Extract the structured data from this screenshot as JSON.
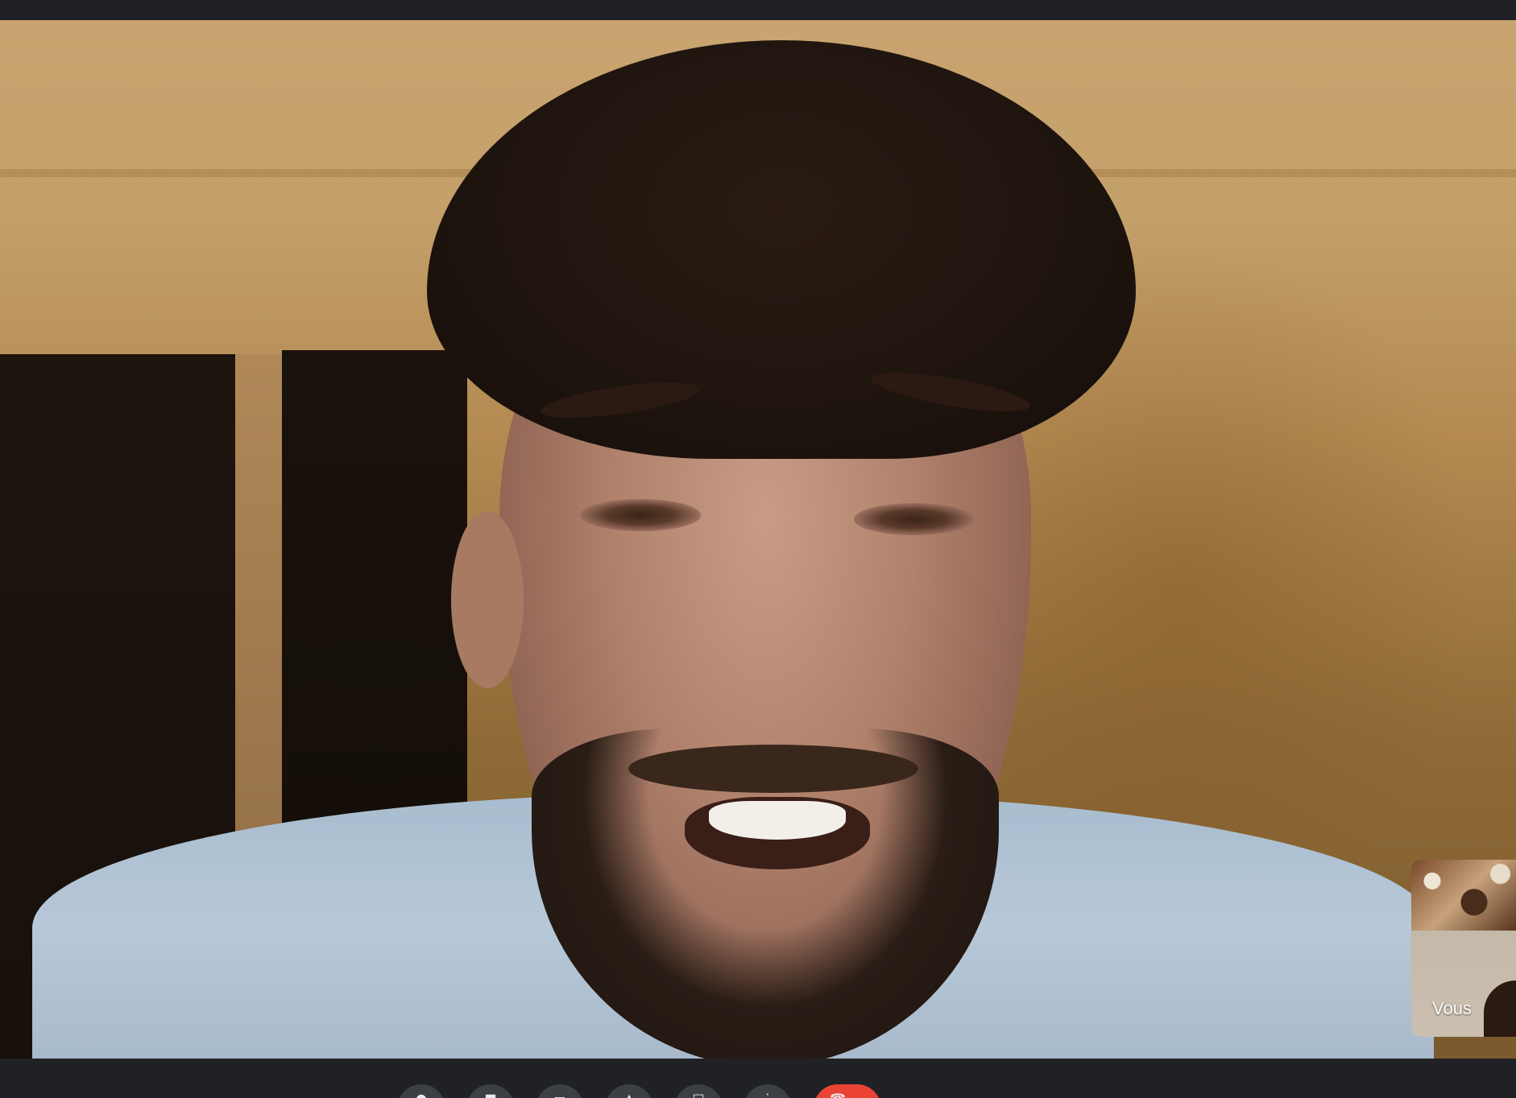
{
  "self_view": {
    "label": "Vous"
  },
  "controls": {
    "buttons": [
      {
        "icon": "microphone-icon"
      },
      {
        "icon": "camera-icon"
      },
      {
        "icon": "captions-icon"
      },
      {
        "icon": "raise-hand-icon"
      },
      {
        "icon": "present-screen-icon"
      },
      {
        "icon": "more-options-icon"
      },
      {
        "icon": "end-call-icon"
      }
    ]
  },
  "colors": {
    "background": "#202124",
    "control_button": "#3c4043",
    "end_call": "#ea4335",
    "label_text": "#ffffff"
  }
}
